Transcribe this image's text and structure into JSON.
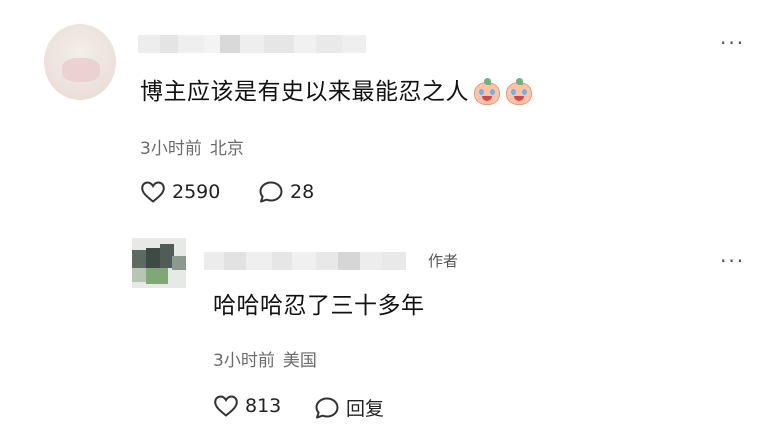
{
  "comment": {
    "text": "博主应该是有史以来最能忍之人",
    "emoji": [
      "crying-laughing-emoji",
      "crying-laughing-emoji"
    ],
    "time": "3小时前",
    "location": "北京",
    "likes": "2590",
    "replies": "28"
  },
  "reply": {
    "author_tag": "作者",
    "text": "哈哈哈忍了三十多年",
    "time": "3小时前",
    "location": "美国",
    "likes": "813",
    "reply_label": "回复"
  },
  "more_label": "···",
  "colors": {
    "text": "#111111",
    "meta": "#6b6b6b",
    "icon": "#333333"
  }
}
